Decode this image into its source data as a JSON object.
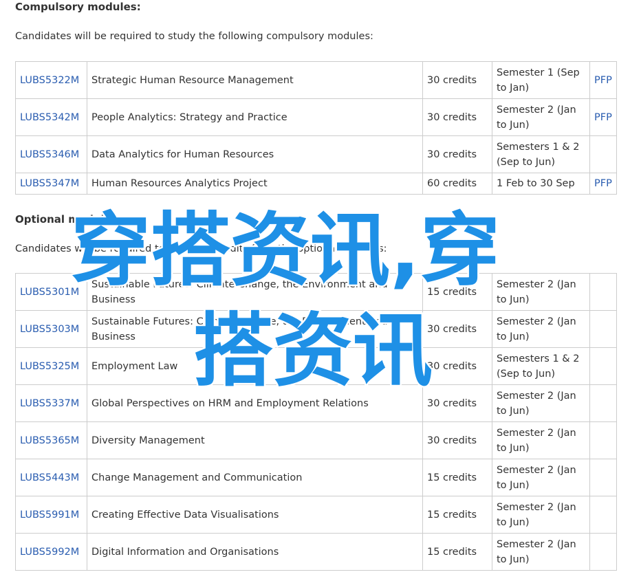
{
  "compulsory": {
    "heading": "Compulsory modules:",
    "intro": "Candidates will be required to study the following compulsory modules:",
    "rows": [
      {
        "code": "LUBS5322M",
        "title": "Strategic Human Resource Management",
        "credits": "30 credits",
        "semester": "Semester 1 (Sep to Jan)",
        "pfp": "PFP"
      },
      {
        "code": "LUBS5342M",
        "title": "People Analytics: Strategy and Practice",
        "credits": "30 credits",
        "semester": "Semester 2 (Jan to Jun)",
        "pfp": "PFP"
      },
      {
        "code": "LUBS5346M",
        "title": "Data Analytics for Human Resources",
        "credits": "30 credits",
        "semester": "Semesters 1 & 2 (Sep to Jun)",
        "pfp": ""
      },
      {
        "code": "LUBS5347M",
        "title": "Human Resources Analytics Project",
        "credits": "60 credits",
        "semester": "1 Feb to 30 Sep",
        "pfp": "PFP"
      }
    ]
  },
  "optional": {
    "heading": "Optional modules:",
    "intro": "Candidates will be required to study 30 credits from the optional modules:",
    "rows": [
      {
        "code": "LUBS5301M",
        "title": "Sustainable Futures: Climate Change, the Environment and Business",
        "credits": "15 credits",
        "semester": "Semester 2 (Jan to Jun)",
        "pfp": ""
      },
      {
        "code": "LUBS5303M",
        "title": "Sustainable Futures: Climate Change, the Environment and Business",
        "credits": "30 credits",
        "semester": "Semester 2 (Jan to Jun)",
        "pfp": ""
      },
      {
        "code": "LUBS5325M",
        "title": "Employment Law",
        "credits": "30 credits",
        "semester": "Semesters 1 & 2 (Sep to Jun)",
        "pfp": ""
      },
      {
        "code": "LUBS5337M",
        "title": "Global Perspectives on HRM and Employment Relations",
        "credits": "30 credits",
        "semester": "Semester 2 (Jan to Jun)",
        "pfp": ""
      },
      {
        "code": "LUBS5365M",
        "title": "Diversity Management",
        "credits": "30 credits",
        "semester": "Semester 2 (Jan to Jun)",
        "pfp": ""
      },
      {
        "code": "LUBS5443M",
        "title": "Change Management and Communication",
        "credits": "15 credits",
        "semester": "Semester 2 (Jan to Jun)",
        "pfp": ""
      },
      {
        "code": "LUBS5991M",
        "title": "Creating Effective Data Visualisations",
        "credits": "15 credits",
        "semester": "Semester 2 (Jan to Jun)",
        "pfp": ""
      },
      {
        "code": "LUBS5992M",
        "title": "Digital Information and Organisations",
        "credits": "15 credits",
        "semester": "Semester 2 (Jan to Jun)",
        "pfp": ""
      }
    ]
  },
  "watermark": {
    "line1": "穿搭资讯,穿",
    "line2": "搭资讯",
    "color": "#1e90e6"
  },
  "colors": {
    "link": "#2a5db0",
    "text": "#333333",
    "border": "#cccccc"
  }
}
